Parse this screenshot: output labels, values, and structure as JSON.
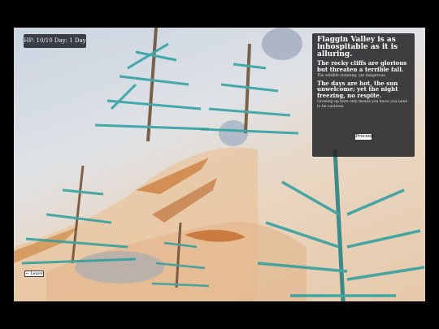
{
  "hud": {
    "status": "HP: 10/10 Day: 1 Day"
  },
  "panel": {
    "title": "Flaggin Valley is as inhospitable as it is alluring.",
    "line2": "The rocky cliffs are glorious but threaten a terrible fall.",
    "line3": "The wildlife stunning, yet dangerous.",
    "line4": "The days are hot, the sun unwelcome; yet the night freezing, no respite.",
    "line5": "Growing up here only means you know you need to be cautious.",
    "proceed_label": "Proceed"
  },
  "leave_label": "← Leave",
  "colors": {
    "background": "#000000",
    "panel_bg": "#232326",
    "tree_teal": "#2a9ea0",
    "earth_orange": "#c9752e"
  }
}
